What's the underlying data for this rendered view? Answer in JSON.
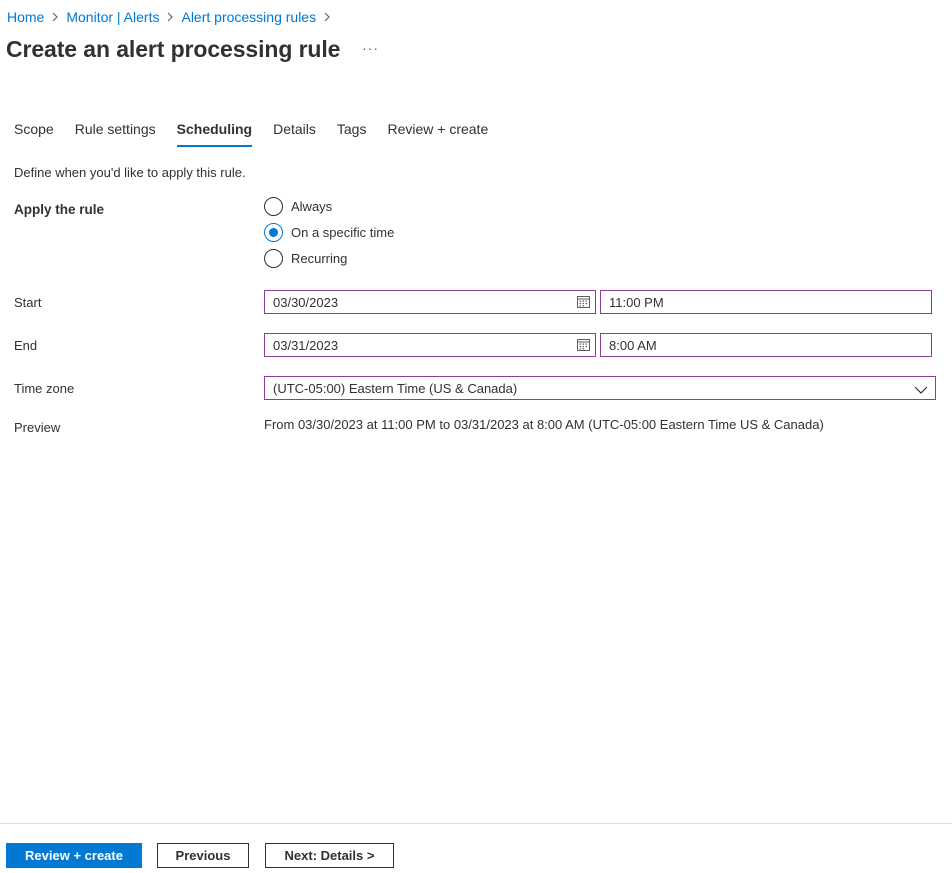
{
  "breadcrumb": {
    "items": [
      "Home",
      "Monitor | Alerts",
      "Alert processing rules"
    ]
  },
  "page": {
    "title": "Create an alert processing rule",
    "more_label": "···"
  },
  "tabs": [
    {
      "label": "Scope",
      "active": false
    },
    {
      "label": "Rule settings",
      "active": false
    },
    {
      "label": "Scheduling",
      "active": true
    },
    {
      "label": "Details",
      "active": false
    },
    {
      "label": "Tags",
      "active": false
    },
    {
      "label": "Review + create",
      "active": false
    }
  ],
  "scheduling": {
    "description": "Define when you'd like to apply this rule.",
    "apply_rule_label": "Apply the rule",
    "options": [
      {
        "label": "Always",
        "selected": false
      },
      {
        "label": "On a specific time",
        "selected": true
      },
      {
        "label": "Recurring",
        "selected": false
      }
    ],
    "start": {
      "label": "Start",
      "date": "03/30/2023",
      "time": "11:00 PM"
    },
    "end": {
      "label": "End",
      "date": "03/31/2023",
      "time": "8:00 AM"
    },
    "timezone": {
      "label": "Time zone",
      "value": "(UTC-05:00) Eastern Time (US & Canada)"
    },
    "preview": {
      "label": "Preview",
      "text": "From 03/30/2023 at 11:00 PM to 03/31/2023 at 8:00 AM (UTC-05:00 Eastern Time US & Canada)"
    }
  },
  "footer": {
    "review_create": "Review + create",
    "previous": "Previous",
    "next": "Next: Details >"
  },
  "colors": {
    "accent": "#0078d4",
    "field_border": "#8a3d9c",
    "text": "#323130"
  },
  "icons": {
    "breadcrumb_separator": "chevron-right-icon",
    "date_picker": "calendar-icon",
    "dropdown": "chevron-down-icon"
  }
}
